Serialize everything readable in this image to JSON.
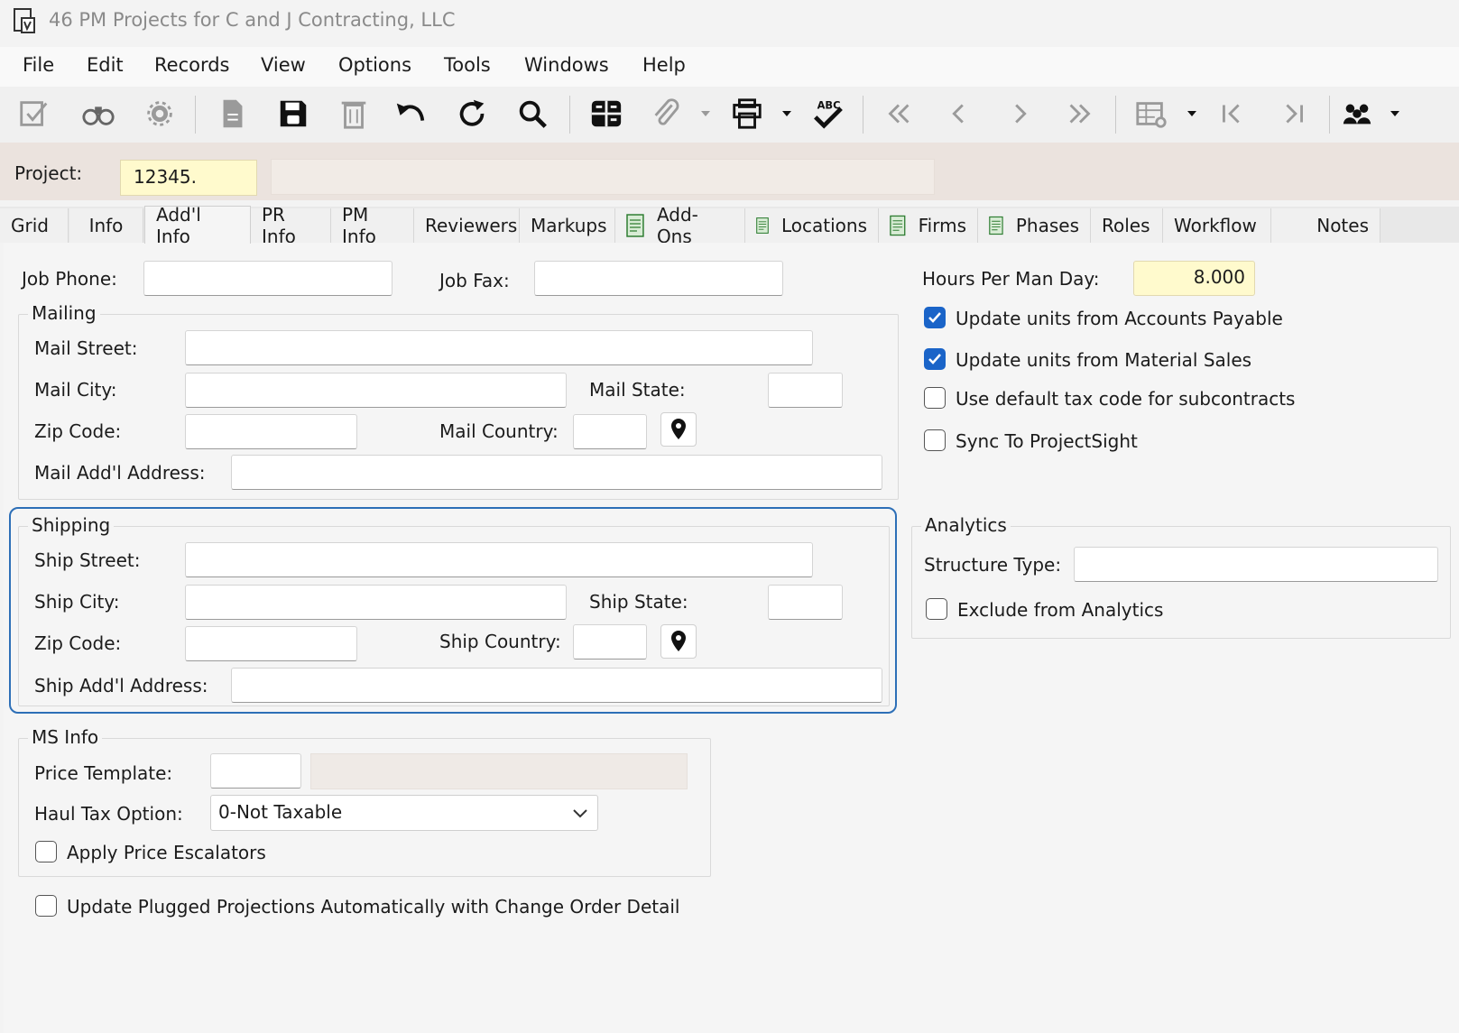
{
  "window": {
    "title": "46 PM Projects for C and J Contracting, LLC"
  },
  "menu": [
    "File",
    "Edit",
    "Records",
    "View",
    "Options",
    "Tools",
    "Windows",
    "Help"
  ],
  "toolbar_icons": [
    "edit-icon",
    "find-icon",
    "settings-icon",
    "new-record-icon",
    "save-icon",
    "delete-icon",
    "undo-icon",
    "refresh-icon",
    "search-icon",
    "grid-icon",
    "attach-icon",
    "print-icon",
    "spellcheck-icon",
    "first-record-icon",
    "prev-record-icon",
    "next-record-icon",
    "last-record-icon",
    "table-settings-icon",
    "jump-first-icon",
    "jump-last-icon",
    "users-icon"
  ],
  "project": {
    "label": "Project:",
    "value": "12345."
  },
  "tabs": [
    {
      "label": "Grid"
    },
    {
      "label": "Info"
    },
    {
      "label": "Add'l Info"
    },
    {
      "label": "PR Info"
    },
    {
      "label": "PM Info"
    },
    {
      "label": "Reviewers"
    },
    {
      "label": "Markups"
    },
    {
      "label": "Add-Ons"
    },
    {
      "label": "Locations"
    },
    {
      "label": "Firms"
    },
    {
      "label": "Phases"
    },
    {
      "label": "Roles"
    },
    {
      "label": "Workflow"
    },
    {
      "label": "Notes"
    }
  ],
  "form": {
    "job_phone": {
      "label": "Job Phone:",
      "value": ""
    },
    "job_fax": {
      "label": "Job Fax:",
      "value": ""
    },
    "mailing": {
      "title": "Mailing",
      "street_label": "Mail Street:",
      "city_label": "Mail City:",
      "state_label": "Mail State:",
      "zip_label": "Zip Code:",
      "country_label": "Mail Country:",
      "addl_label": "Mail Add'l Address:"
    },
    "shipping": {
      "title": "Shipping",
      "street_label": "Ship Street:",
      "city_label": "Ship City:",
      "state_label": "Ship State:",
      "zip_label": "Zip Code:",
      "country_label": "Ship Country:",
      "addl_label": "Ship Add'l Address:"
    },
    "ms_info": {
      "title": "MS Info",
      "price_template_label": "Price Template:",
      "haul_tax_label": "Haul Tax Option:",
      "haul_tax_value": "0-Not Taxable",
      "apply_escalators_label": "Apply Price Escalators"
    },
    "update_plugged_label": "Update Plugged Projections Automatically with Change Order Detail",
    "hours_per_man_day": {
      "label": "Hours Per Man Day:",
      "value": "8.000"
    },
    "checks": {
      "update_ap": {
        "label": "Update units from Accounts Payable",
        "checked": true
      },
      "update_ms": {
        "label": "Update units from Material Sales",
        "checked": true
      },
      "default_tax": {
        "label": "Use default tax code for subcontracts",
        "checked": false
      },
      "sync_ps": {
        "label": "Sync To ProjectSight",
        "checked": false
      }
    },
    "analytics": {
      "title": "Analytics",
      "structure_type_label": "Structure Type:",
      "exclude_label": "Exclude from Analytics"
    }
  },
  "colors": {
    "accent": "#1a64c8",
    "focus": "#2d6fb7",
    "project_bg": "#ebe3de",
    "highlight_field": "#fffacd"
  }
}
